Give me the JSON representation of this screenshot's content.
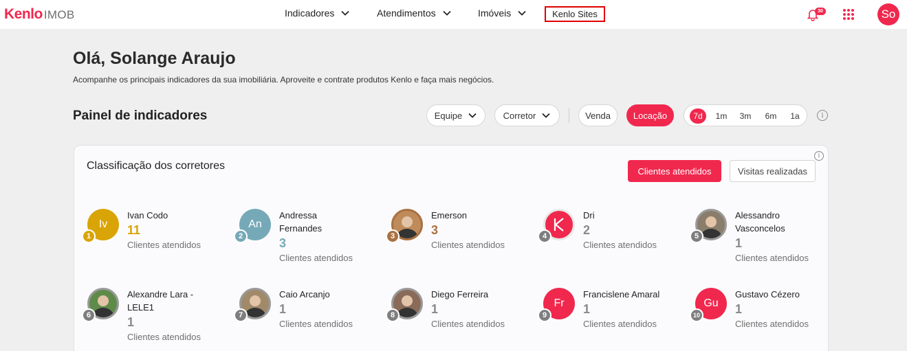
{
  "header": {
    "logo_main": "Kenlo",
    "logo_sub": "IMOB",
    "nav": [
      "Indicadores",
      "Atendimentos",
      "Imóveis"
    ],
    "kenlo_sites": "Kenlo Sites",
    "notification_count": "30",
    "user_initials": "So"
  },
  "greeting": {
    "title": "Olá, Solange Araujo",
    "subtitle": "Acompanhe os principais indicadores da sua imobiliária. Aproveite e contrate produtos Kenlo e faça mais negócios."
  },
  "panel": {
    "title": "Painel de indicadores",
    "filters": {
      "team": "Equipe",
      "broker": "Corretor"
    },
    "modes": {
      "sale": "Venda",
      "rent": "Locação",
      "active": "Locação"
    },
    "ranges": [
      "7d",
      "1m",
      "3m",
      "6m",
      "1a"
    ],
    "active_range": "7d",
    "info": "i"
  },
  "ranking": {
    "title": "Classificação dos corretores",
    "tab_clients": "Clientes atendidos",
    "tab_visits": "Visitas realizadas",
    "info": "i",
    "metric_label": "Clientes atendidos",
    "brokers": [
      {
        "rank": "1",
        "name_lines": [
          "Ivan Codo"
        ],
        "count": "11",
        "initials": "Iv",
        "avatar_color": "#d9a406",
        "rank_color": "#d9a406",
        "count_color": "#d9a406"
      },
      {
        "rank": "2",
        "name_lines": [
          "Andressa",
          "Fernandes"
        ],
        "count": "3",
        "initials": "An",
        "avatar_color": "#76a9b8",
        "rank_color": "#76a9b8",
        "count_color": "#76a9b8"
      },
      {
        "rank": "3",
        "name_lines": [
          "Emerson"
        ],
        "count": "3",
        "initials": "",
        "avatar_color": "#bf8b5a",
        "rank_color": "#a97142",
        "count_color": "#a97142"
      },
      {
        "rank": "4",
        "name_lines": [
          "Dri"
        ],
        "count": "2",
        "initials": "",
        "avatar_color": "#f0284e",
        "rank_color": "#7e7e7e",
        "count_color": "#8a8a8a"
      },
      {
        "rank": "5",
        "name_lines": [
          "Alessandro",
          "Vasconcelos"
        ],
        "count": "1",
        "initials": "",
        "avatar_color": "#8b7d6b",
        "rank_color": "#7e7e7e",
        "count_color": "#8a8a8a"
      },
      {
        "rank": "6",
        "name_lines": [
          "Alexandre Lara -",
          "LELE1"
        ],
        "count": "1",
        "initials": "",
        "avatar_color": "#5f8b4a",
        "rank_color": "#7e7e7e",
        "count_color": "#8a8a8a"
      },
      {
        "rank": "7",
        "name_lines": [
          "Caio Arcanjo"
        ],
        "count": "1",
        "initials": "",
        "avatar_color": "#a08a6a",
        "rank_color": "#7e7e7e",
        "count_color": "#8a8a8a"
      },
      {
        "rank": "8",
        "name_lines": [
          "Diego Ferreira"
        ],
        "count": "1",
        "initials": "",
        "avatar_color": "#8a6b5a",
        "rank_color": "#7e7e7e",
        "count_color": "#8a8a8a"
      },
      {
        "rank": "9",
        "name_lines": [
          "Francislene Amaral"
        ],
        "count": "1",
        "initials": "Fr",
        "avatar_color": "#f0284e",
        "rank_color": "#7e7e7e",
        "count_color": "#8a8a8a"
      },
      {
        "rank": "10",
        "name_lines": [
          "Gustavo Cézero"
        ],
        "count": "1",
        "initials": "Gu",
        "avatar_color": "#f0284e",
        "rank_color": "#7e7e7e",
        "count_color": "#8a8a8a"
      }
    ]
  }
}
